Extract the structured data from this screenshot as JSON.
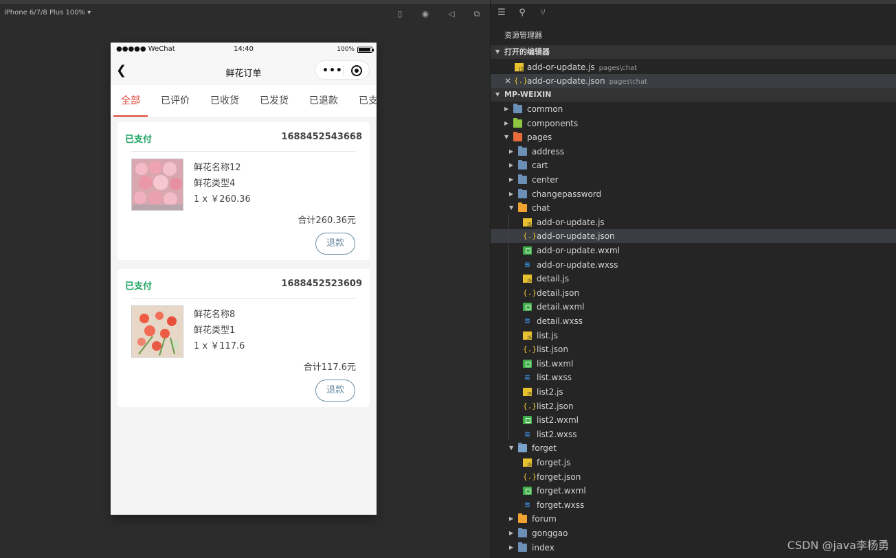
{
  "simulator": {
    "device_label": "iPhone 6/7/8 Plus 100% ▾",
    "toolbar_icons": [
      "phone-icon",
      "record-icon",
      "sound-icon",
      "window-icon"
    ]
  },
  "phone": {
    "status_left": "●●●●● WeChat",
    "time": "14:40",
    "battery": "100%",
    "nav_title": "鲜花订单",
    "tabs": [
      "全部",
      "已评价",
      "已收货",
      "已发货",
      "已退款",
      "已支"
    ],
    "active_tab": 0,
    "accent_color": "#e04434",
    "orders": [
      {
        "status": "已支付",
        "order_no": "1688452543668",
        "product_name": "鲜花名称12",
        "product_type": "鲜花类型4",
        "price_line": "1 x ￥260.36",
        "subtotal": "合计260.36元",
        "action": "退款"
      },
      {
        "status": "已支付",
        "order_no": "1688452523609",
        "product_name": "鲜花名称8",
        "product_type": "鲜花类型1",
        "price_line": "1 x ￥117.6",
        "subtotal": "合计117.6元",
        "action": "退款"
      }
    ]
  },
  "explorer": {
    "title": "资源管理器",
    "open_editors_label": "打开的编辑器",
    "open_editors": [
      {
        "name": "add-or-update.js",
        "path": "pages\\chat",
        "type": "js"
      },
      {
        "name": "add-or-update.json",
        "path": "pages\\chat",
        "type": "json"
      }
    ],
    "project_label": "MP-WEIXIN",
    "tree": [
      {
        "name": "common",
        "kind": "folder"
      },
      {
        "name": "components",
        "kind": "folder"
      },
      {
        "name": "pages",
        "kind": "folder-open"
      },
      {
        "name": "address",
        "kind": "folder"
      },
      {
        "name": "cart",
        "kind": "folder"
      },
      {
        "name": "center",
        "kind": "folder"
      },
      {
        "name": "changepassword",
        "kind": "folder"
      },
      {
        "name": "chat",
        "kind": "folder-open"
      },
      {
        "name": "add-or-update.js",
        "kind": "js"
      },
      {
        "name": "add-or-update.json",
        "kind": "json"
      },
      {
        "name": "add-or-update.wxml",
        "kind": "wxml"
      },
      {
        "name": "add-or-update.wxss",
        "kind": "wxss"
      },
      {
        "name": "detail.js",
        "kind": "js"
      },
      {
        "name": "detail.json",
        "kind": "json"
      },
      {
        "name": "detail.wxml",
        "kind": "wxml"
      },
      {
        "name": "detail.wxss",
        "kind": "wxss"
      },
      {
        "name": "list.js",
        "kind": "js"
      },
      {
        "name": "list.json",
        "kind": "json"
      },
      {
        "name": "list.wxml",
        "kind": "wxml"
      },
      {
        "name": "list.wxss",
        "kind": "wxss"
      },
      {
        "name": "list2.js",
        "kind": "js"
      },
      {
        "name": "list2.json",
        "kind": "json"
      },
      {
        "name": "list2.wxml",
        "kind": "wxml"
      },
      {
        "name": "list2.wxss",
        "kind": "wxss"
      },
      {
        "name": "forget",
        "kind": "folder-open"
      },
      {
        "name": "forget.js",
        "kind": "js"
      },
      {
        "name": "forget.json",
        "kind": "json"
      },
      {
        "name": "forget.wxml",
        "kind": "wxml"
      },
      {
        "name": "forget.wxss",
        "kind": "wxss"
      },
      {
        "name": "forum",
        "kind": "folder"
      },
      {
        "name": "gonggao",
        "kind": "folder"
      },
      {
        "name": "index",
        "kind": "folder"
      }
    ],
    "watermark": "CSDN @java李杨勇"
  }
}
